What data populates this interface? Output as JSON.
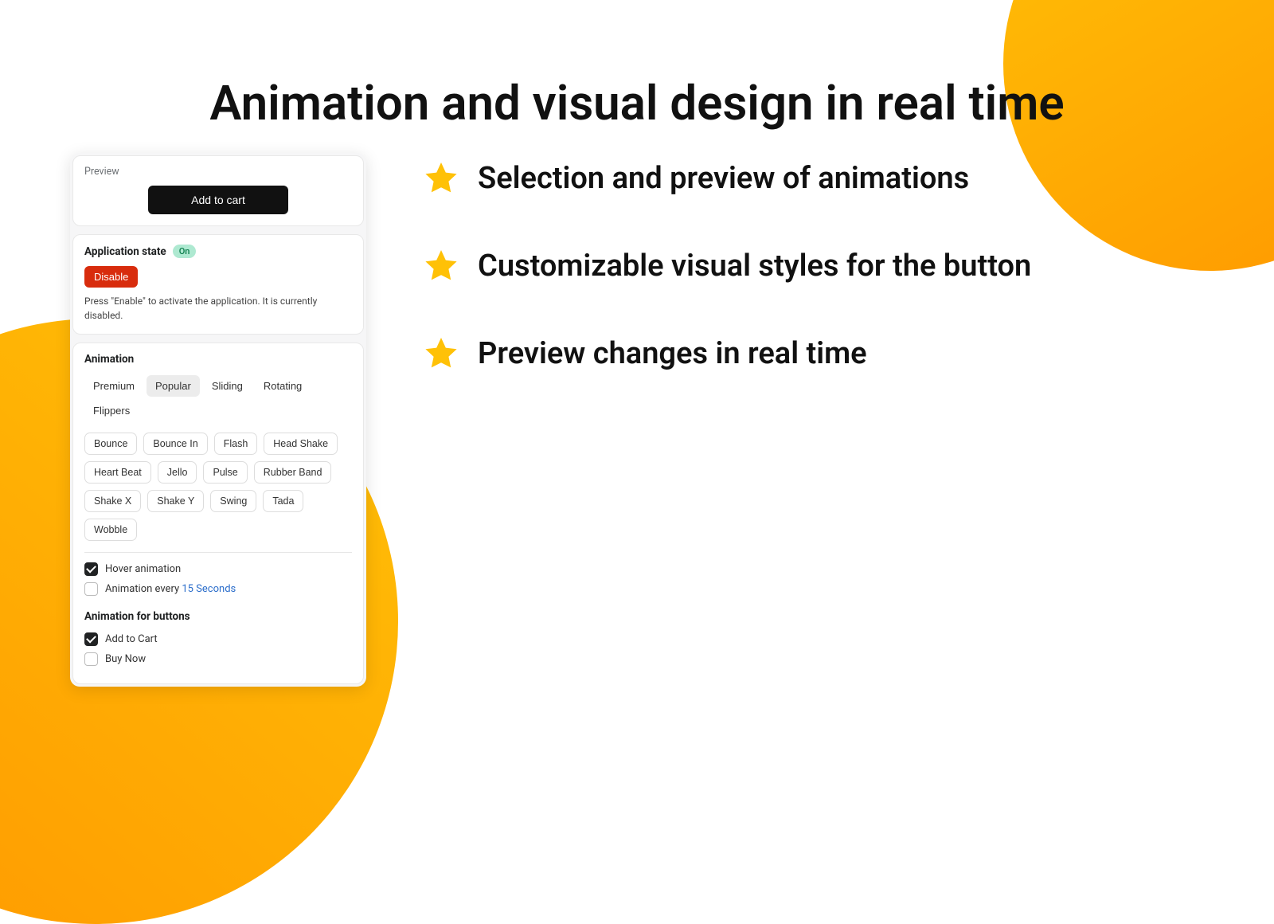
{
  "headline": "Animation and visual design in real time",
  "features": [
    "Selection and preview of animations",
    "Customizable visual styles for the button",
    "Preview changes in real time"
  ],
  "panel": {
    "preview": {
      "label": "Preview",
      "button": "Add to cart"
    },
    "state": {
      "title": "Application state",
      "badge": "On",
      "action": "Disable",
      "help": "Press \"Enable\" to activate the application. It is currently disabled."
    },
    "animation": {
      "title": "Animation",
      "tabs": [
        "Premium",
        "Popular",
        "Sliding",
        "Rotating",
        "Flippers"
      ],
      "activeTab": "Popular",
      "chips": [
        "Bounce",
        "Bounce In",
        "Flash",
        "Head Shake",
        "Heart Beat",
        "Jello",
        "Pulse",
        "Rubber Band",
        "Shake X",
        "Shake Y",
        "Swing",
        "Tada",
        "Wobble"
      ],
      "hover": {
        "label": "Hover animation",
        "checked": true
      },
      "every": {
        "prefix": "Animation every ",
        "value": "15 Seconds",
        "checked": false
      }
    },
    "buttons": {
      "title": "Animation for buttons",
      "items": [
        {
          "label": "Add to Cart",
          "checked": true
        },
        {
          "label": "Buy Now",
          "checked": false
        }
      ]
    }
  }
}
